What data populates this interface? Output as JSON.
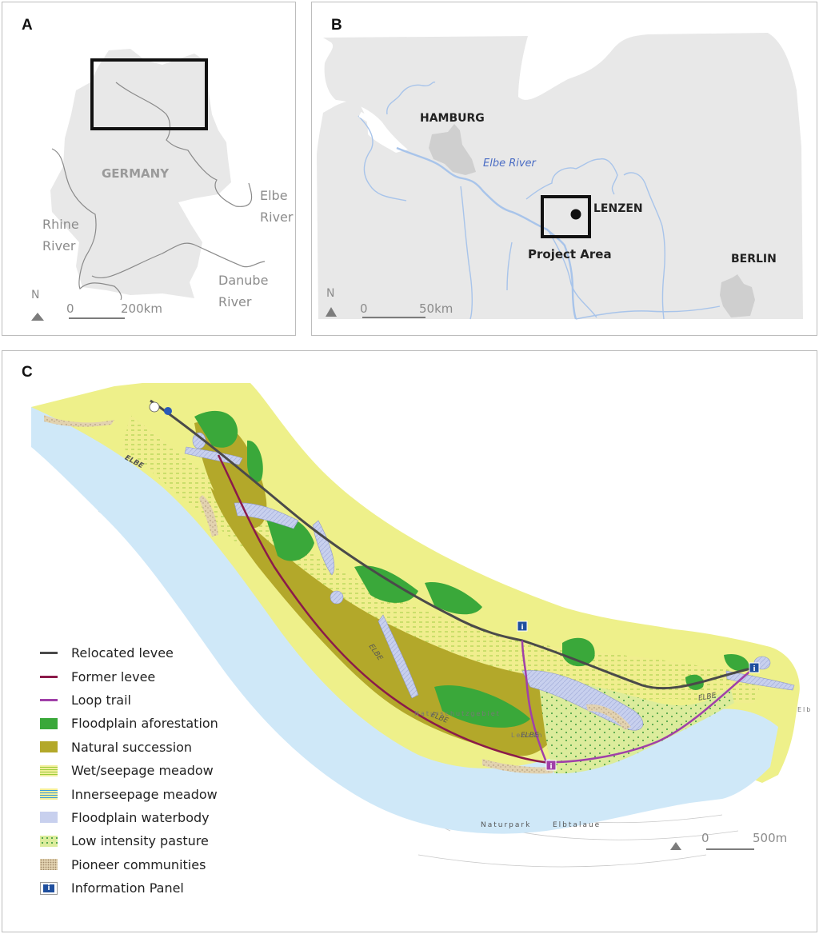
{
  "figure": {
    "panels": [
      {
        "id": "A",
        "label": "A",
        "country_label": "GERMANY",
        "rivers": [
          {
            "name": "Elbe River",
            "line1": "Elbe",
            "line2": "River"
          },
          {
            "name": "Rhine River",
            "line1": "Rhine",
            "line2": "River"
          },
          {
            "name": "Danube River",
            "line1": "Danube",
            "line2": "River"
          }
        ],
        "north_label": "N",
        "scale": {
          "start": "0",
          "end": "200km"
        }
      },
      {
        "id": "B",
        "label": "B",
        "cities": [
          "HAMBURG",
          "LENZEN",
          "BERLIN"
        ],
        "river_label": "Elbe River",
        "project_label": "Project Area",
        "north_label": "N",
        "scale": {
          "start": "0",
          "end": "50km"
        }
      },
      {
        "id": "C",
        "label": "C",
        "map_labels": {
          "river": "ELBE",
          "naturpark": "Naturpark",
          "elbtalaue": "Elbtalaue",
          "naturschutzgebiet": "Naturschutzgebiet",
          "lenzen": "Lenzen",
          "elb_fragment": "Elb"
        },
        "scale": {
          "start": "0",
          "end": "500m"
        },
        "legend": [
          {
            "label": "Relocated levee",
            "kind": "line",
            "color": "#4a4a4a"
          },
          {
            "label": "Former levee",
            "kind": "line",
            "color": "#8b1a4a"
          },
          {
            "label": "Loop trail",
            "kind": "line",
            "color": "#a040a8"
          },
          {
            "label": "Floodplain aforestation",
            "kind": "fill",
            "color": "#3aa83a"
          },
          {
            "label": "Natural succession",
            "kind": "fill",
            "color": "#b3a82a"
          },
          {
            "label": "Wet/seepage meadow",
            "kind": "pattern",
            "color": "#f2ee9a",
            "pattern_color": "#9ccc3c"
          },
          {
            "label": "Innerseepage meadow",
            "kind": "pattern",
            "color": "#f2ee9a",
            "pattern_color": "#3a9ad8"
          },
          {
            "label": "Floodplain waterbody",
            "kind": "fill",
            "color": "#c8d0ee"
          },
          {
            "label": "Low intensity pasture",
            "kind": "pattern",
            "color": "#dcec9c",
            "pattern_color": "#3c9a3c"
          },
          {
            "label": "Pioneer communities",
            "kind": "pattern",
            "color": "#e2d2b0",
            "pattern_color": "#a08868"
          },
          {
            "label": "Information Panel",
            "kind": "icon",
            "color": "#1f4f9e",
            "glyph": "i"
          }
        ]
      }
    ],
    "colors": {
      "land_gray": "#e8e8e8",
      "city_gray": "#cfcfcf",
      "river_blue": "#a8c4ea",
      "label_gray": "#8c8c8c",
      "water_blue": "#cfe8f8",
      "meadow_yellow": "#eef08a"
    }
  }
}
